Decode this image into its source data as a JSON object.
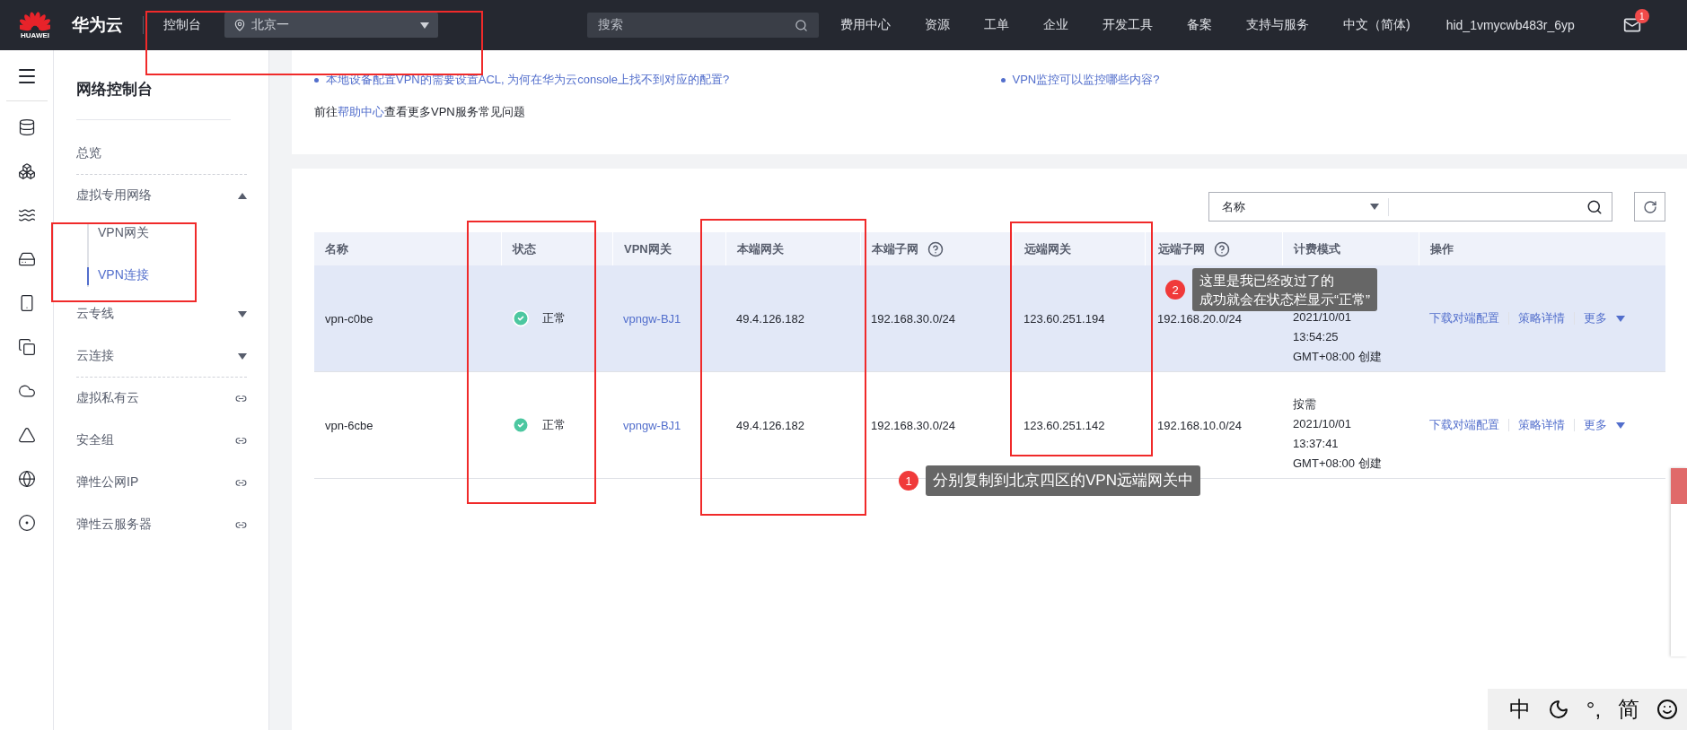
{
  "topbar": {
    "logo_text": "HUAWEI",
    "brand": "华为云",
    "console": "控制台",
    "region": "北京一",
    "search_placeholder": "搜索",
    "nav": [
      "费用中心",
      "资源",
      "工单",
      "企业",
      "开发工具",
      "备案",
      "支持与服务",
      "中文（简体)"
    ],
    "user": "hid_1vmycwb483r_6yp",
    "mail_badge": "1"
  },
  "sidebar": {
    "title": "网络控制台",
    "items": [
      {
        "label": "总览",
        "kind": "plain",
        "divider_after": true
      },
      {
        "label": "虚拟专用网络",
        "kind": "group",
        "expanded": true,
        "divider_after": false,
        "children": [
          {
            "label": "VPN网关",
            "selected": false
          },
          {
            "label": "VPN连接",
            "selected": true
          }
        ]
      },
      {
        "label": "云专线",
        "kind": "group",
        "expanded": false,
        "divider_after": false
      },
      {
        "label": "云连接",
        "kind": "group",
        "expanded": false,
        "divider_after": true
      },
      {
        "label": "虚拟私有云",
        "kind": "link",
        "divider_after": false
      },
      {
        "label": "安全组",
        "kind": "link",
        "divider_after": false
      },
      {
        "label": "弹性公网IP",
        "kind": "link",
        "divider_after": false
      },
      {
        "label": "弹性云服务器",
        "kind": "link",
        "divider_after": false
      }
    ]
  },
  "faq": {
    "links": [
      "本地设备配置VPN的需要设置ACL, 为何在华为云console上找不到对应的配置?",
      "VPN监控可以监控哪些内容?"
    ],
    "more": {
      "prefix": "前往",
      "link": "帮助中心",
      "suffix": "查看更多VPN服务常见问题"
    }
  },
  "table": {
    "filter": {
      "field": "名称"
    },
    "columns": [
      {
        "label": "名称",
        "help": false
      },
      {
        "label": "状态",
        "help": false
      },
      {
        "label": "VPN网关",
        "help": false
      },
      {
        "label": "本端网关",
        "help": false
      },
      {
        "label": "本端子网",
        "help": true
      },
      {
        "label": "远端网关",
        "help": false
      },
      {
        "label": "远端子网",
        "help": true
      },
      {
        "label": "计费模式",
        "help": false
      },
      {
        "label": "操作",
        "help": false
      }
    ],
    "rows": [
      {
        "highlighted": true,
        "name": "vpn-c0be",
        "status": "正常",
        "vpn_gateway": "vpngw-BJ1",
        "local_gateway": "49.4.126.182",
        "local_subnet": "192.168.30.0/24",
        "remote_gateway": "123.60.251.194",
        "remote_subnet": "192.168.20.0/24",
        "billing": [
          "2021/10/01",
          "13:54:25",
          "GMT+08:00 创建"
        ],
        "actions": [
          "下载对端配置",
          "策略详情",
          "更多"
        ]
      },
      {
        "highlighted": false,
        "name": "vpn-6cbe",
        "status": "正常",
        "vpn_gateway": "vpngw-BJ1",
        "local_gateway": "49.4.126.182",
        "local_subnet": "192.168.30.0/24",
        "remote_gateway": "123.60.251.142",
        "remote_subnet": "192.168.10.0/24",
        "billing": [
          "按需",
          "2021/10/01",
          "13:37:41",
          "GMT+08:00 创建"
        ],
        "actions": [
          "下载对端配置",
          "策略详情",
          "更多"
        ]
      }
    ]
  },
  "callouts": [
    {
      "number": "1",
      "lines": [
        "分别复制到北京四区的VPN远端网关中"
      ]
    },
    {
      "number": "2",
      "lines": [
        "这里是我已经改过了的",
        "成功就会在状态栏显示“正常”"
      ]
    }
  ],
  "ime": [
    {
      "kind": "text",
      "label": "中"
    },
    {
      "kind": "moon"
    },
    {
      "kind": "text",
      "label": "°,"
    },
    {
      "kind": "text",
      "label": "简"
    },
    {
      "kind": "smiley"
    }
  ]
}
